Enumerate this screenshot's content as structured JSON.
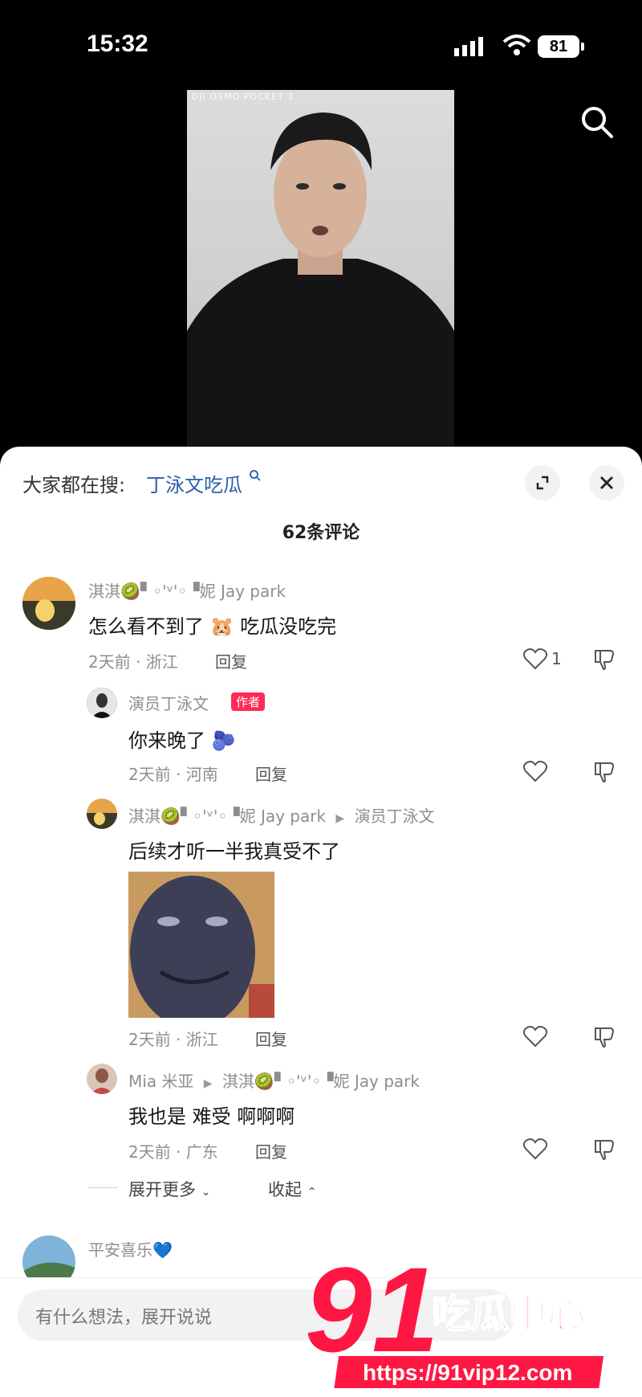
{
  "status": {
    "time": "15:32",
    "battery": "81"
  },
  "video": {
    "watermark": "DJI OSMO POCKET 3"
  },
  "sheet": {
    "search_prefix": "大家都在搜:",
    "search_term": "丁泳文吃瓜",
    "comment_count": "62条评论"
  },
  "comments": [
    {
      "name": "淇淇🥝▘◦'ᵛ'◦▝妮 Jay park",
      "text": "怎么看不到了 🐹 吃瓜没吃完",
      "meta": "2天前 · 浙江",
      "reply": "回复",
      "likes": "1"
    },
    {
      "name": "演员丁泳文",
      "badge": "作者",
      "text": "你来晚了 🫐",
      "meta": "2天前 · 河南",
      "reply": "回复"
    },
    {
      "name": "淇淇🥝▘◦'ᵛ'◦▝妮 Jay park",
      "reply_to": "演员丁泳文",
      "text": "后续才听一半我真受不了",
      "meta": "2天前 · 浙江",
      "reply": "回复"
    },
    {
      "name": "Mia 米亚",
      "reply_to": "淇淇🥝▘◦'ᵛ'◦▝妮 Jay park",
      "text": "我也是 难受 啊啊啊",
      "meta": "2天前 · 广东",
      "reply": "回复"
    },
    {
      "name": "平安喜乐💙"
    }
  ],
  "thread_controls": {
    "expand": "展开更多",
    "collapse": "收起"
  },
  "input": {
    "placeholder": "有什么想法，展开说说"
  },
  "watermark": {
    "big": "91",
    "cn": "吃瓜中心",
    "url": "https://91vip12.com"
  },
  "colors": {
    "accent": "#fe2c55",
    "link": "#2a5fa8",
    "watermark_red": "#ff1744"
  }
}
